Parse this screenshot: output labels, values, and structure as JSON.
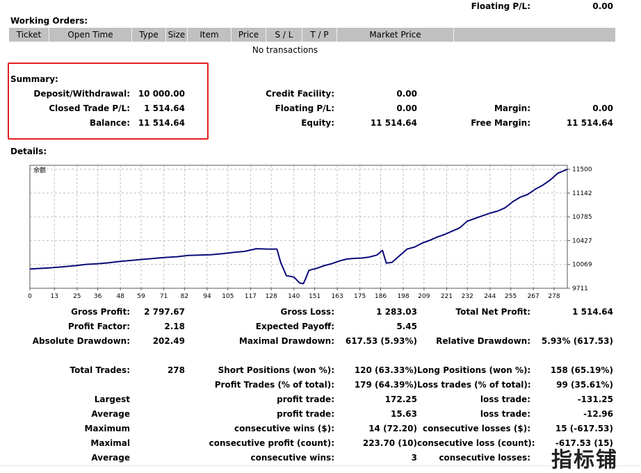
{
  "floating_top": {
    "label": "Floating P/L:",
    "value": "0.00"
  },
  "working_orders": {
    "title": "Working Orders:",
    "columns": [
      "Ticket",
      "Open Time",
      "Type",
      "Size",
      "Item",
      "Price",
      "S / L",
      "T / P",
      "Market Price"
    ],
    "empty_text": "No transactions"
  },
  "summary": {
    "title": "Summary:",
    "deposit_label": "Deposit/Withdrawal:",
    "deposit_value": "10 000.00",
    "closed_label": "Closed Trade P/L:",
    "closed_value": "1 514.64",
    "balance_label": "Balance:",
    "balance_value": "11 514.64",
    "credit_label": "Credit Facility:",
    "credit_value": "0.00",
    "floating_label": "Floating P/L:",
    "floating_value": "0.00",
    "equity_label": "Equity:",
    "equity_value": "11 514.64",
    "margin_label": "Margin:",
    "margin_value": "0.00",
    "free_margin_label": "Free Margin:",
    "free_margin_value": "11 514.64"
  },
  "details": {
    "title": "Details:"
  },
  "chart_data": {
    "type": "line",
    "title": "余额",
    "xlabel": "",
    "ylabel": "",
    "xlim": [
      0,
      285
    ],
    "ylim": [
      9711,
      11559
    ],
    "x_ticks": [
      0,
      13,
      25,
      36,
      48,
      59,
      71,
      82,
      94,
      105,
      117,
      128,
      140,
      151,
      163,
      175,
      186,
      198,
      209,
      221,
      232,
      244,
      255,
      267,
      278
    ],
    "y_ticks": [
      9711,
      10069,
      10427,
      10785,
      11142,
      11500
    ],
    "grid": true,
    "line_color": "#0a0a7a",
    "series": [
      {
        "x": [
          0,
          6,
          12,
          18,
          24,
          30,
          36,
          42,
          48,
          54,
          60,
          66,
          72,
          78,
          84,
          90,
          96,
          102,
          108,
          114,
          120,
          126,
          131,
          133,
          136,
          140,
          143,
          145,
          146,
          148,
          152,
          156,
          160,
          164,
          168,
          172,
          176,
          180,
          184,
          187,
          189,
          192,
          196,
          200,
          204,
          208,
          212,
          216,
          220,
          224,
          228,
          232,
          236,
          240,
          244,
          248,
          252,
          256,
          260,
          264,
          268,
          272,
          276,
          280,
          285
        ],
        "y": [
          10000,
          10010,
          10020,
          10035,
          10050,
          10070,
          10080,
          10095,
          10115,
          10130,
          10145,
          10160,
          10175,
          10185,
          10205,
          10210,
          10215,
          10230,
          10250,
          10265,
          10305,
          10300,
          10300,
          10100,
          9900,
          9880,
          9790,
          9780,
          9840,
          9980,
          10010,
          10050,
          10080,
          10120,
          10150,
          10160,
          10165,
          10180,
          10210,
          10280,
          10090,
          10100,
          10200,
          10300,
          10330,
          10390,
          10430,
          10480,
          10520,
          10570,
          10620,
          10720,
          10760,
          10800,
          10840,
          10870,
          10920,
          11010,
          11080,
          11120,
          11200,
          11260,
          11340,
          11440,
          11500
        ]
      }
    ]
  },
  "stats": {
    "gross_profit_label": "Gross Profit:",
    "gross_profit": "2 797.67",
    "gross_loss_label": "Gross Loss:",
    "gross_loss": "1 283.03",
    "total_net_label": "Total Net Profit:",
    "total_net": "1 514.64",
    "profit_factor_label": "Profit Factor:",
    "profit_factor": "2.18",
    "expected_payoff_label": "Expected Payoff:",
    "expected_payoff": "5.45",
    "abs_dd_label": "Absolute Drawdown:",
    "abs_dd": "202.49",
    "max_dd_label": "Maximal Drawdown:",
    "max_dd": "617.53 (5.93%)",
    "rel_dd_label": "Relative Drawdown:",
    "rel_dd": "5.93% (617.53)",
    "total_trades_label": "Total Trades:",
    "total_trades": "278",
    "short_label": "Short Positions (won %):",
    "short_value": "120 (63.33%)",
    "long_label": "Long Positions (won %):",
    "long_value": "158 (65.19%)",
    "profit_trades_label": "Profit Trades (% of total):",
    "profit_trades": "179 (64.39%)",
    "loss_trades_label": "Loss trades (% of total):",
    "loss_trades": "99 (35.61%)",
    "largest_label": "Largest",
    "largest_profit_label": "profit trade:",
    "largest_profit": "172.25",
    "largest_loss_label": "loss trade:",
    "largest_loss": "-131.25",
    "average_label": "Average",
    "avg_profit_label": "profit trade:",
    "avg_profit": "15.63",
    "avg_loss_label": "loss trade:",
    "avg_loss": "-12.96",
    "maximum_label": "Maximum",
    "max_wins_label": "consecutive wins ($):",
    "max_wins": "14 (72.20)",
    "max_losses_label": "consecutive losses ($):",
    "max_losses": "15 (-617.53)",
    "maximal_label": "Maximal",
    "maximal_profit_label": "consecutive profit (count):",
    "maximal_profit": "223.70 (10)",
    "maximal_loss_label": "consecutive loss (count):",
    "maximal_loss": "-617.53 (15)",
    "average2_label": "Average",
    "avg_wins_label": "consecutive wins:",
    "avg_wins": "3",
    "avg_losses_label": "consecutive losses:",
    "avg_losses": ""
  },
  "watermark": "指标铺"
}
